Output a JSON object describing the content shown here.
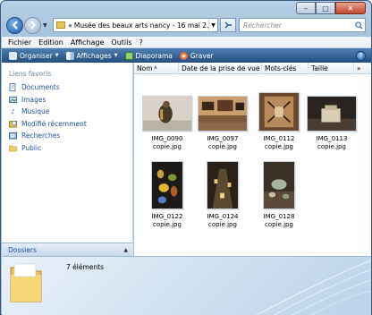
{
  "window": {
    "caption_buttons": {
      "minimize": "–",
      "maximize": "□",
      "close": "✕"
    }
  },
  "nav": {
    "back_icon": "back-arrow-icon",
    "forward_icon": "forward-arrow-icon",
    "address_chevron": "«",
    "address_text": "Musée des beaux arts nancy - 16 mai 2...",
    "search_placeholder": "Rechercher"
  },
  "menu": {
    "items": [
      "Fichier",
      "Edition",
      "Affichage",
      "Outils",
      "?"
    ]
  },
  "toolbar": {
    "organize": "Organiser",
    "views": "Affichages",
    "slideshow": "Diaporama",
    "burn": "Graver"
  },
  "left_pane": {
    "title": "Liens favoris",
    "items": [
      {
        "label": "Documents",
        "icon": "documents-icon"
      },
      {
        "label": "Images",
        "icon": "images-icon"
      },
      {
        "label": "Musique",
        "icon": "music-icon"
      },
      {
        "label": "Modifié récemment",
        "icon": "recent-icon"
      },
      {
        "label": "Recherches",
        "icon": "search-icon"
      },
      {
        "label": "Public",
        "icon": "folder-icon"
      }
    ],
    "folders_label": "Dossiers"
  },
  "columns": [
    "Nom",
    "Date de la prise de vue",
    "Mots-clés",
    "Taille",
    "»"
  ],
  "files": [
    {
      "name": "IMG_0090",
      "ext": "copie.jpg"
    },
    {
      "name": "IMG_0097",
      "ext": "copie.jpg"
    },
    {
      "name": "IMG_0112",
      "ext": "copie.jpg"
    },
    {
      "name": "IMG_0113",
      "ext": "copie.jpg"
    },
    {
      "name": "IMG_0122",
      "ext": "copie.jpg"
    },
    {
      "name": "IMG_0124",
      "ext": "copie.jpg"
    },
    {
      "name": "IMG_0128",
      "ext": "copie.jpg"
    }
  ],
  "details": {
    "count_text": "7 éléments"
  },
  "colors": {
    "toolbar": "#244d7d",
    "link": "#1f4f99"
  }
}
